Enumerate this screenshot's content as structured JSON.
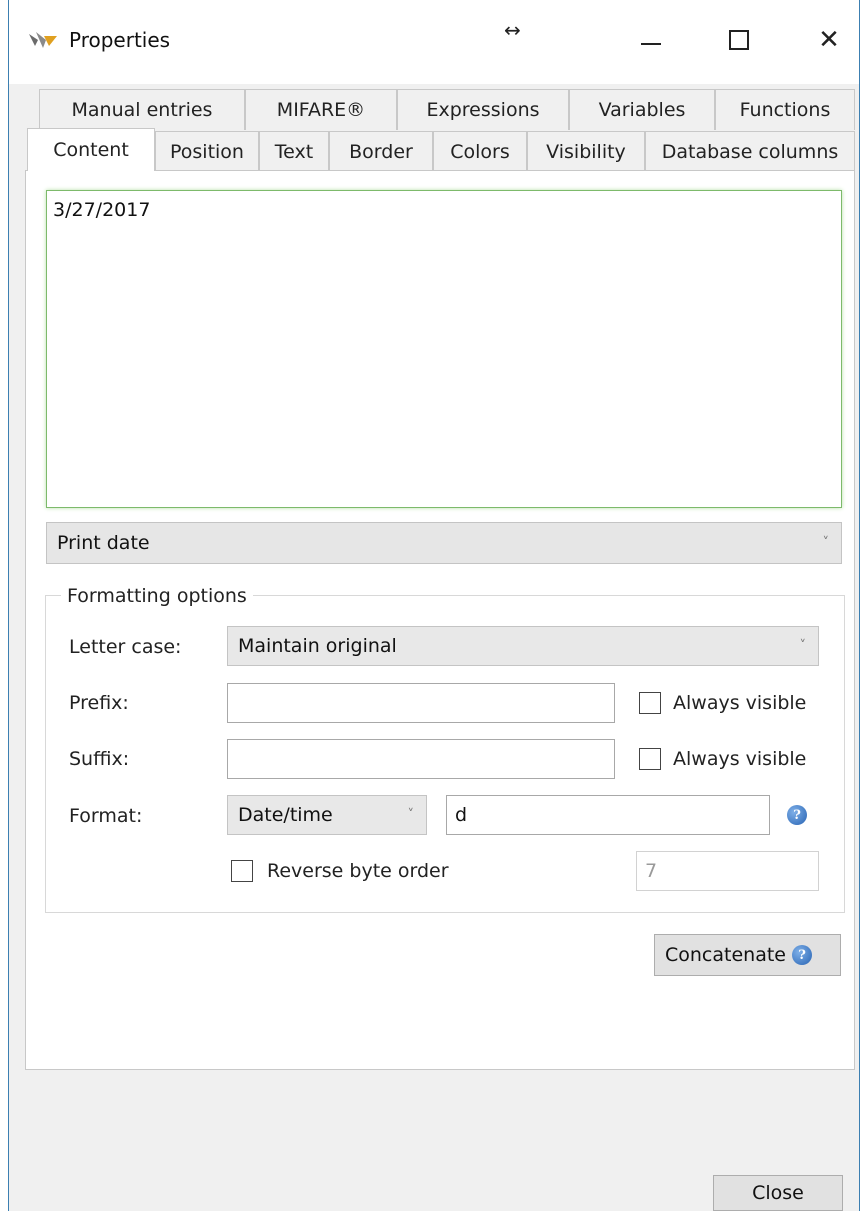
{
  "window": {
    "title": "Properties"
  },
  "tabs_row1": [
    "Manual entries",
    "MIFARE®",
    "Expressions",
    "Variables",
    "Functions"
  ],
  "tabs_row2": [
    "Content",
    "Position",
    "Text",
    "Border",
    "Colors",
    "Visibility",
    "Database columns"
  ],
  "active_tab": "Content",
  "content": {
    "text": "3/27/2017",
    "source_select": "Print date"
  },
  "formatting": {
    "legend": "Formatting options",
    "letter_case_label": "Letter case:",
    "letter_case_value": "Maintain original",
    "prefix_label": "Prefix:",
    "prefix_value": "",
    "prefix_always_visible": "Always visible",
    "suffix_label": "Suffix:",
    "suffix_value": "",
    "suffix_always_visible": "Always visible",
    "format_label": "Format:",
    "format_type": "Date/time",
    "format_value": "d",
    "reverse_byte_order_label": "Reverse byte order",
    "byte_count_value": "7"
  },
  "buttons": {
    "concatenate": "Concatenate",
    "close": "Close"
  },
  "colors": {
    "focus_border": "#7dba6b",
    "window_border": "#3c7fb1",
    "help_icon": "#2763b3"
  },
  "icons": [
    "app-logo-icon",
    "resize-horizontal-icon",
    "minimize-icon",
    "maximize-icon",
    "close-icon",
    "chevron-down-icon",
    "help-icon",
    "checkbox-icon"
  ]
}
